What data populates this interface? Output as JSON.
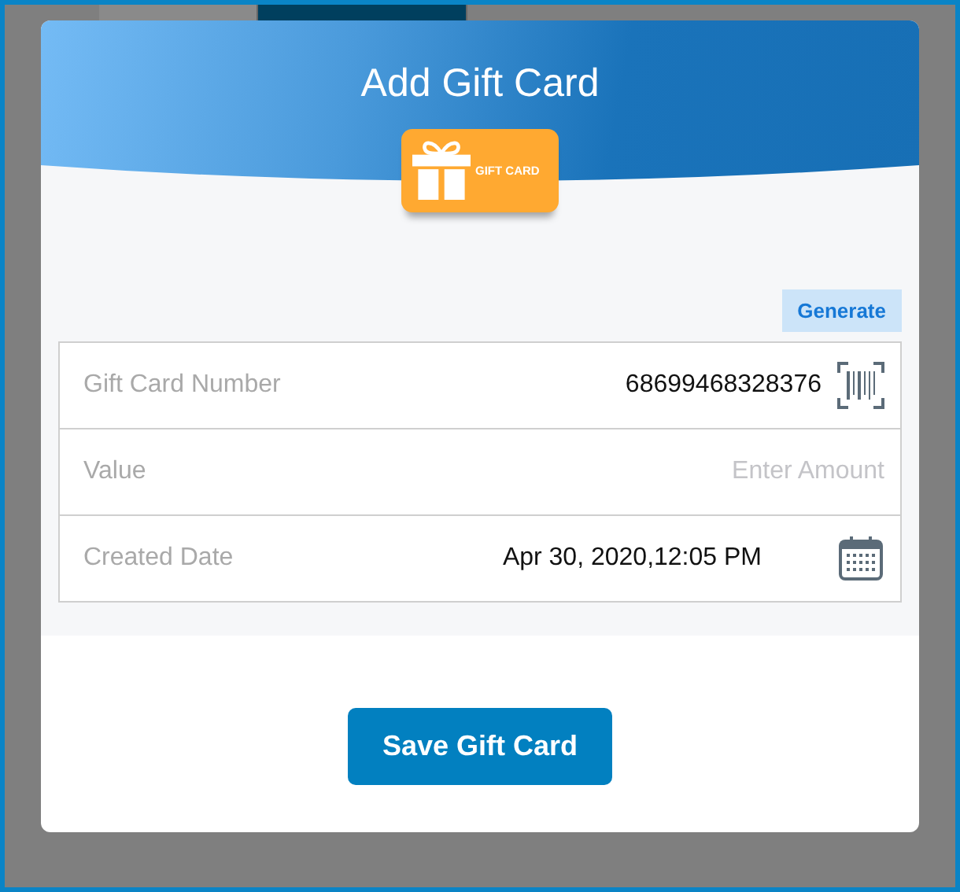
{
  "dialog": {
    "title": "Add Gift Card",
    "card_label": "GIFT CARD"
  },
  "generate_button": "Generate",
  "fields": [
    {
      "kind": "barcode",
      "label": "Gift Card Number",
      "value": "68699468328376"
    },
    {
      "kind": "input",
      "label": "Value",
      "placeholder": "Enter Amount"
    },
    {
      "kind": "date",
      "label": "Created Date",
      "value": "Apr 30, 2020,12:05 PM"
    }
  ],
  "save_button": "Save Gift Card"
}
